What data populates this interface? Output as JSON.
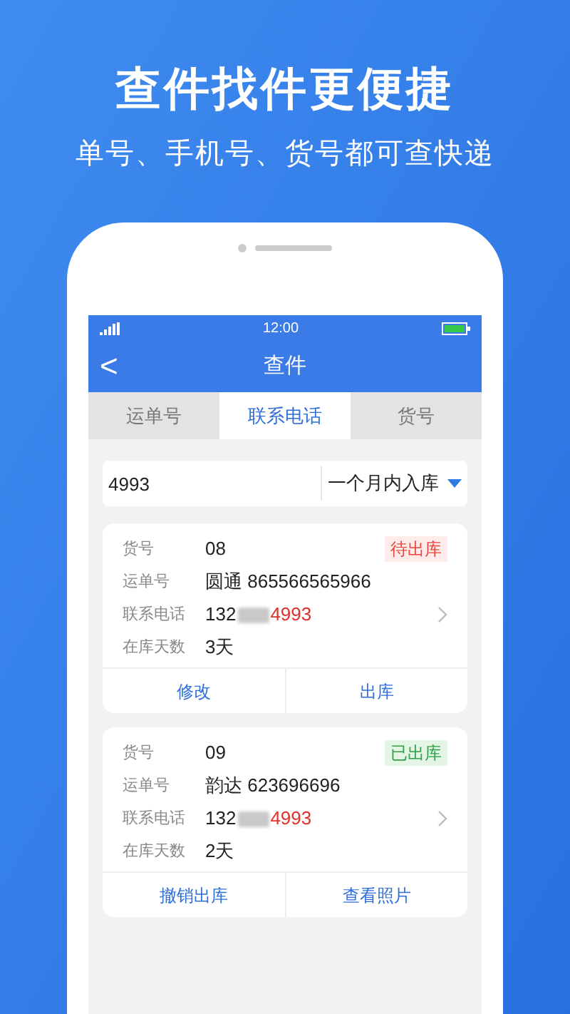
{
  "headline": "查件找件更便捷",
  "subtitle": "单号、手机号、货号都可查快递",
  "status_bar": {
    "time": "12:00"
  },
  "nav": {
    "back": "<",
    "title": "查件"
  },
  "tabs": [
    {
      "label": "运单号",
      "selected": false
    },
    {
      "label": "联系电话",
      "selected": true
    },
    {
      "label": "货号",
      "selected": false
    }
  ],
  "search": {
    "value": "4993",
    "filter": "一个月内入库"
  },
  "records": [
    {
      "goods_label": "货号",
      "goods": "08",
      "status": "待出库",
      "shipped": false,
      "waybill_label": "运单号",
      "waybill": "圆通 865566565966",
      "phone_label": "联系电话",
      "phone_prefix": "132",
      "phone_match": "4993",
      "days_label": "在库天数",
      "days": "3天",
      "actions": [
        "修改",
        "出库"
      ]
    },
    {
      "goods_label": "货号",
      "goods": "09",
      "status": "已出库",
      "shipped": true,
      "waybill_label": "运单号",
      "waybill": "韵达 623696696",
      "phone_label": "联系电话",
      "phone_prefix": "132",
      "phone_match": "4993",
      "days_label": "在库天数",
      "days": "2天",
      "actions": [
        "撤销出库",
        "查看照片"
      ]
    }
  ]
}
